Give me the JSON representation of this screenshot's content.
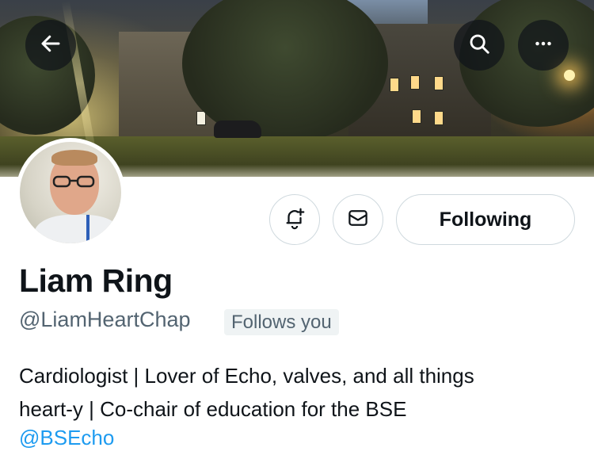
{
  "header": {
    "back_icon": "arrow-left-icon",
    "search_icon": "search-icon",
    "more_icon": "more-horizontal-icon"
  },
  "profile": {
    "name": "Liam Ring",
    "handle": "@LiamHeartChap",
    "follows_you": "Follows you",
    "bio_line1": "Cardiologist | Lover of Echo, valves, and all things",
    "bio_line2": "heart-y | Co-chair of education for the BSE",
    "bio_mention": "@BSEcho"
  },
  "actions": {
    "notify_icon": "bell-plus-icon",
    "message_icon": "mail-icon",
    "following_label": "Following"
  },
  "colors": {
    "link": "#1d9bf0",
    "secondary_text": "#536471",
    "primary_text": "#0f1419"
  }
}
